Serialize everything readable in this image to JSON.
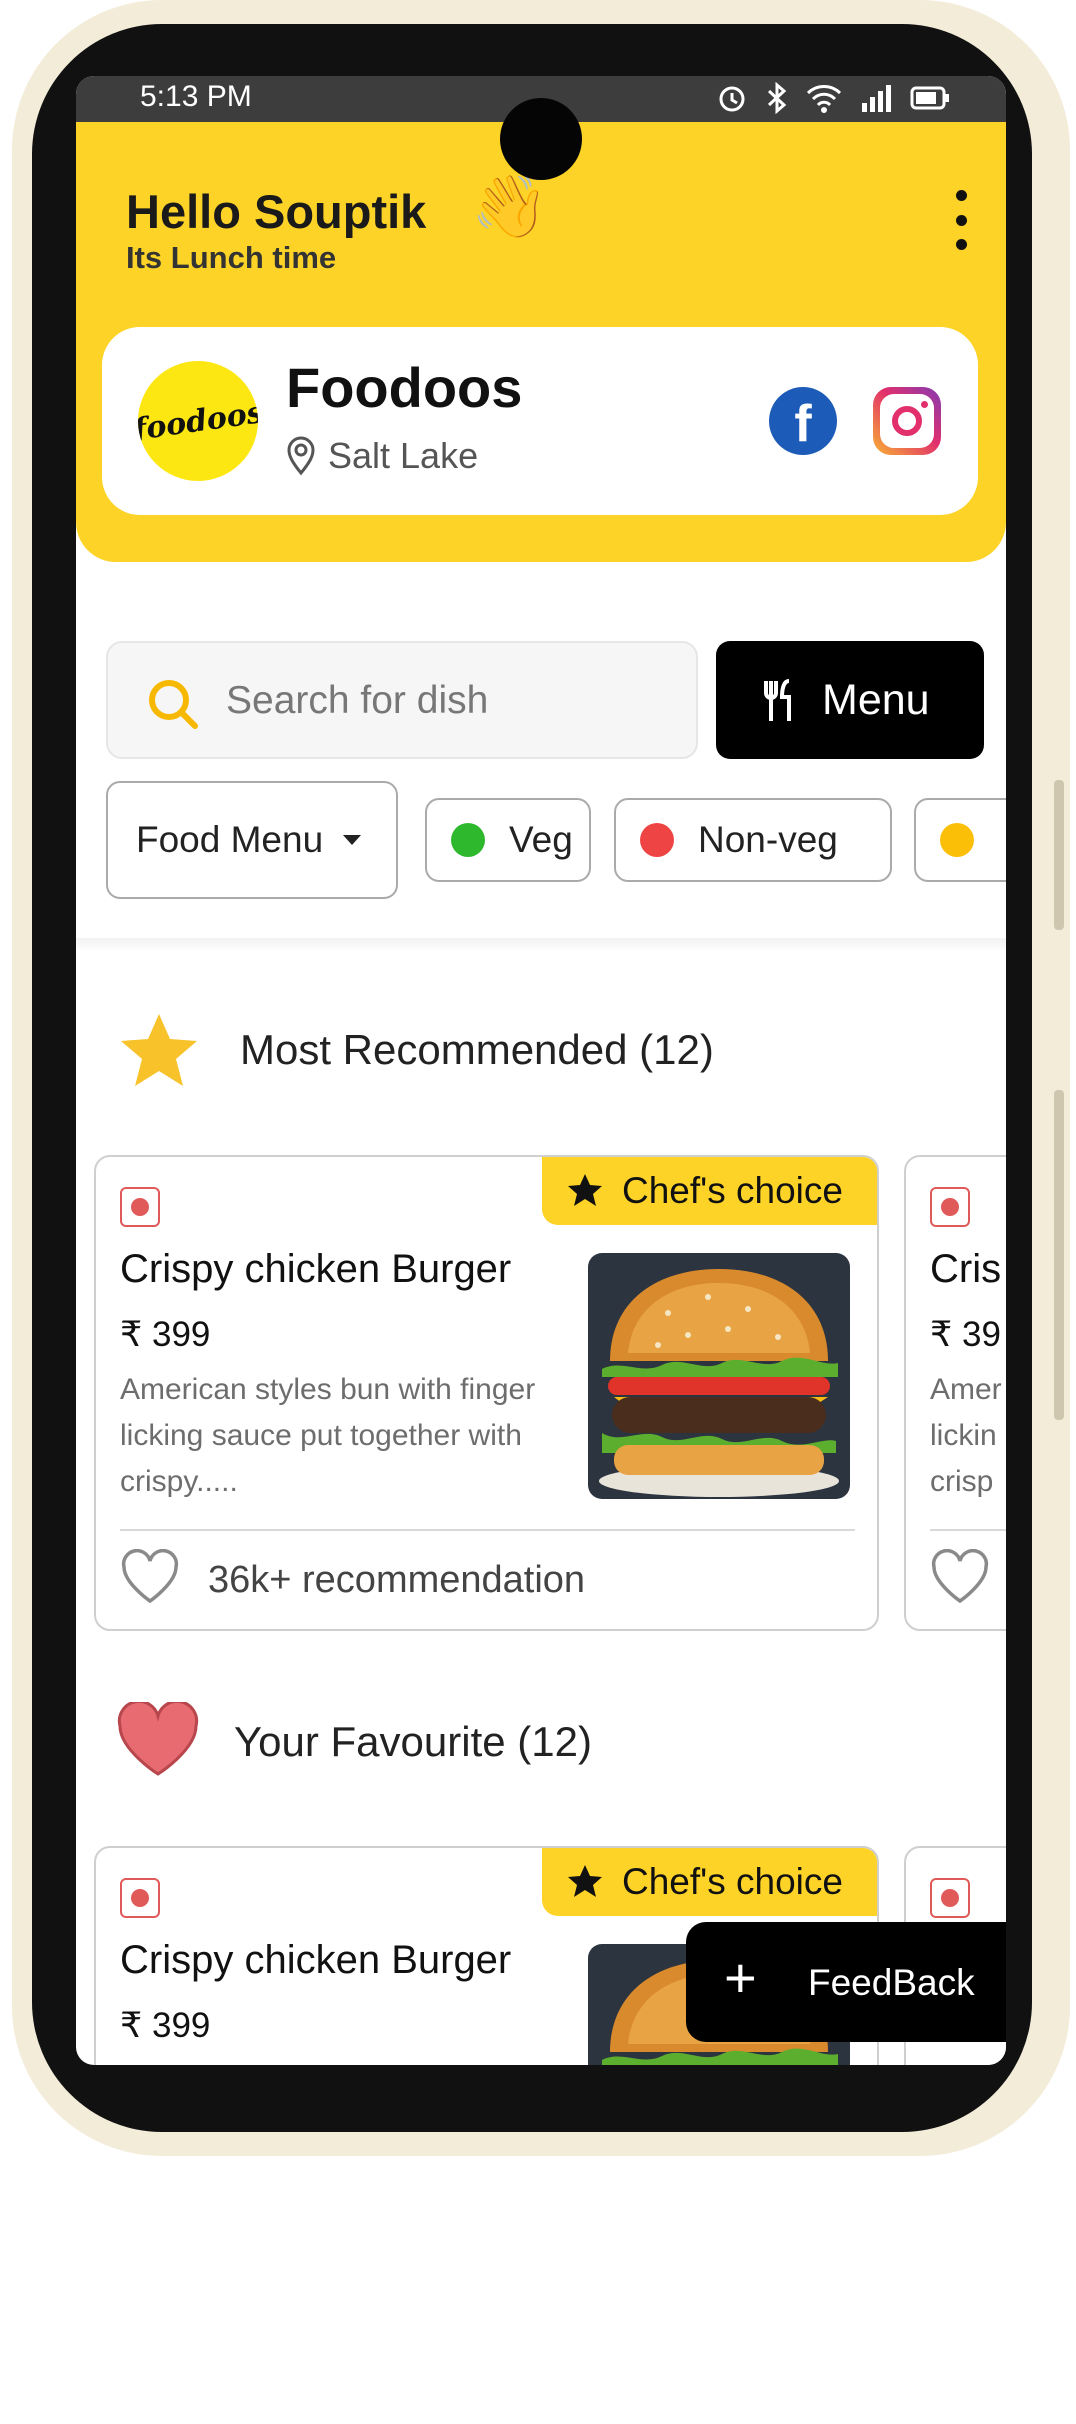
{
  "status_bar": {
    "time": "5:13 PM"
  },
  "header": {
    "greeting": "Hello Souptik",
    "wave_emoji": "👋",
    "subtitle": "Its Lunch time"
  },
  "restaurant": {
    "logo_text": "foodoos",
    "name": "Foodoos",
    "location": "Salt Lake",
    "facebook_glyph": "f"
  },
  "search": {
    "placeholder": "Search for dish"
  },
  "menu_button": {
    "label": "Menu"
  },
  "filters": {
    "dropdown_label": "Food Menu",
    "chips": [
      {
        "label": "Veg",
        "color": "#2eb82e"
      },
      {
        "label": "Non-veg",
        "color": "#ee4444"
      },
      {
        "label": "",
        "color": "#fbbf08"
      }
    ]
  },
  "sections": {
    "recommended_title": "Most Recommended (12)",
    "favourite_title": "Your Favourite (12)"
  },
  "cards": [
    {
      "badge": "Chef's choice",
      "title": "Crispy chicken Burger",
      "price": "₹ 399",
      "desc": "American styles bun with finger licking sauce put together with crispy.....",
      "recommendations": "36k+ recommendation"
    },
    {
      "badge": "Chef's choice",
      "title": "Crispy chicken Burger",
      "price": "₹ 399",
      "desc": ""
    }
  ],
  "peek_cards": [
    {
      "title": "Cris",
      "price": "₹ 39",
      "desc_lines": [
        "Amer",
        "lickin",
        "crisp"
      ]
    },
    {
      "title": "",
      "price": ""
    }
  ],
  "feedback_button": {
    "label": "FeedBack",
    "icon": "+"
  },
  "colors": {
    "accent_yellow": "#fdd327",
    "dark": "#000000",
    "nonveg_red": "#e15a5a",
    "star_yellow": "#f8c22b",
    "heart_red": "#e96b72"
  },
  "icons": [
    "alarm-icon",
    "bluetooth-icon",
    "wifi-icon",
    "signal-icon",
    "battery-icon",
    "kebab-menu-icon",
    "location-pin-icon",
    "facebook-icon",
    "instagram-icon",
    "search-icon",
    "cutlery-icon",
    "caret-down-icon",
    "star-icon",
    "heart-icon",
    "heart-outline-icon",
    "plus-icon"
  ]
}
